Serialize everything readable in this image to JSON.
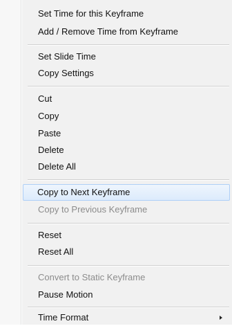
{
  "menu": {
    "items": [
      {
        "label": "Set Time for this Keyframe"
      },
      {
        "label": "Add / Remove Time from Keyframe"
      },
      {
        "label": "Set Slide Time"
      },
      {
        "label": "Copy Settings"
      },
      {
        "label": "Cut"
      },
      {
        "label": "Copy"
      },
      {
        "label": "Paste"
      },
      {
        "label": "Delete"
      },
      {
        "label": "Delete All"
      },
      {
        "label": "Copy to Next Keyframe"
      },
      {
        "label": "Copy to Previous Keyframe"
      },
      {
        "label": "Reset"
      },
      {
        "label": "Reset All"
      },
      {
        "label": "Convert to Static Keyframe"
      },
      {
        "label": "Pause Motion"
      },
      {
        "label": "Time Format"
      }
    ],
    "highlighted_item": "Copy to Next Keyframe",
    "disabled_items": [
      "Copy to Previous Keyframe",
      "Convert to Static Keyframe"
    ],
    "submenu_items": [
      "Time Format"
    ],
    "colors": {
      "background": "#f1f1f1",
      "highlight_border": "#aecff7",
      "highlight_fill": "#dcebfc",
      "disabled_text": "#8c8c8c",
      "text": "#111111"
    }
  }
}
